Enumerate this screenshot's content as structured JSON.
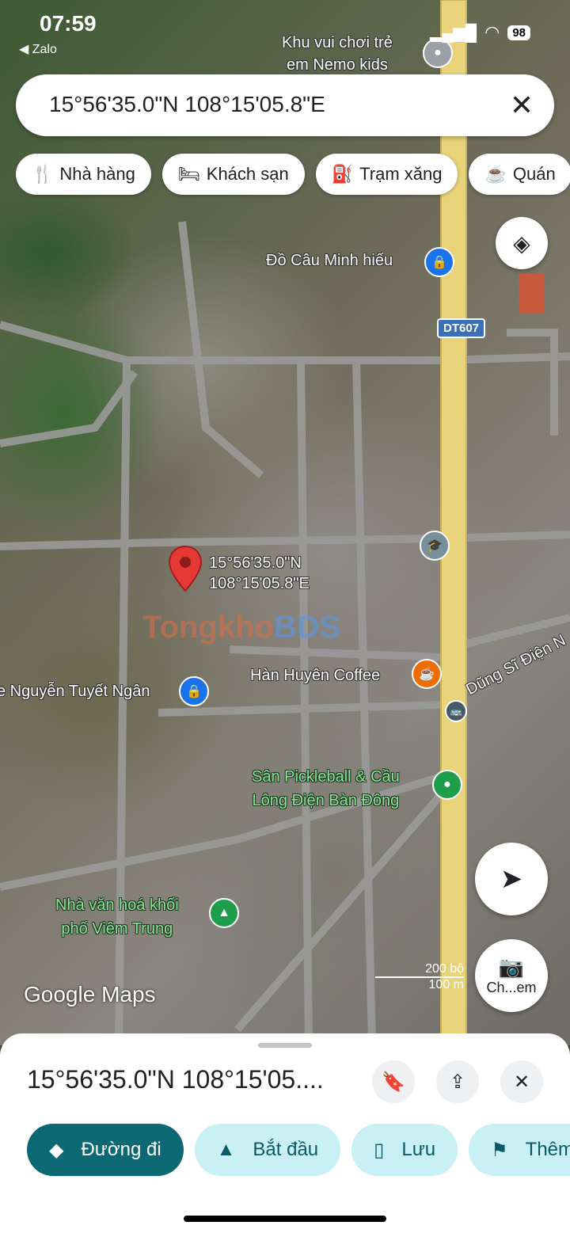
{
  "status": {
    "time": "07:59",
    "back_app": "Zalo",
    "battery": "98"
  },
  "search": {
    "value": "15°56'35.0\"N 108°15'05.8\"E",
    "close_icon": "close-icon"
  },
  "chips": [
    {
      "label": "Nhà hàng",
      "icon": "restaurant-icon"
    },
    {
      "label": "Khách sạn",
      "icon": "hotel-icon"
    },
    {
      "label": "Trạm xăng",
      "icon": "gas-station-icon"
    },
    {
      "label": "Quán",
      "icon": "cafe-icon"
    }
  ],
  "map": {
    "pin_label_line1": "15°56'35.0\"N",
    "pin_label_line2": "108°15'05.8\"E",
    "route_badge": "DT607",
    "places": {
      "nemo_line1": "Khu vui chơi trẻ",
      "nemo_line2": "em Nemo kids",
      "do_cau": "Đồ Câu Minh hiếu",
      "tuyet_ngan": "e Nguyễn Tuyết Ngân",
      "han_huyen": "Hàn Huyên Coffee",
      "dung_si": "Dũng Sĩ Điện N",
      "pickleball_line1": "Sân Pickleball & Cầu",
      "pickleball_line2": "Lông Điện Bàn Đông",
      "nha_van_hoa_line1": "Nhà văn hoá khối",
      "nha_van_hoa_line2": "phố Viêm Trung"
    },
    "watermark_a": "Tongkho",
    "watermark_b": "BDS",
    "logo": "Google Maps",
    "scale_ft": "200 bộ",
    "scale_m": "100 m",
    "lens_label": "Ch...em"
  },
  "sheet": {
    "title": "15°56'35.0\"N 108°15'05....",
    "actions": [
      {
        "label": "Đường đi",
        "icon": "directions-icon"
      },
      {
        "label": "Bắt đầu",
        "icon": "navigate-icon"
      },
      {
        "label": "Lưu",
        "icon": "bookmark-icon"
      },
      {
        "label": "Thêm",
        "icon": "flag-icon"
      }
    ]
  },
  "colors": {
    "accent": "#0c6872",
    "accent_light": "#c9f0f5",
    "pin": "#e53935",
    "road_main": "#e8d27a"
  }
}
